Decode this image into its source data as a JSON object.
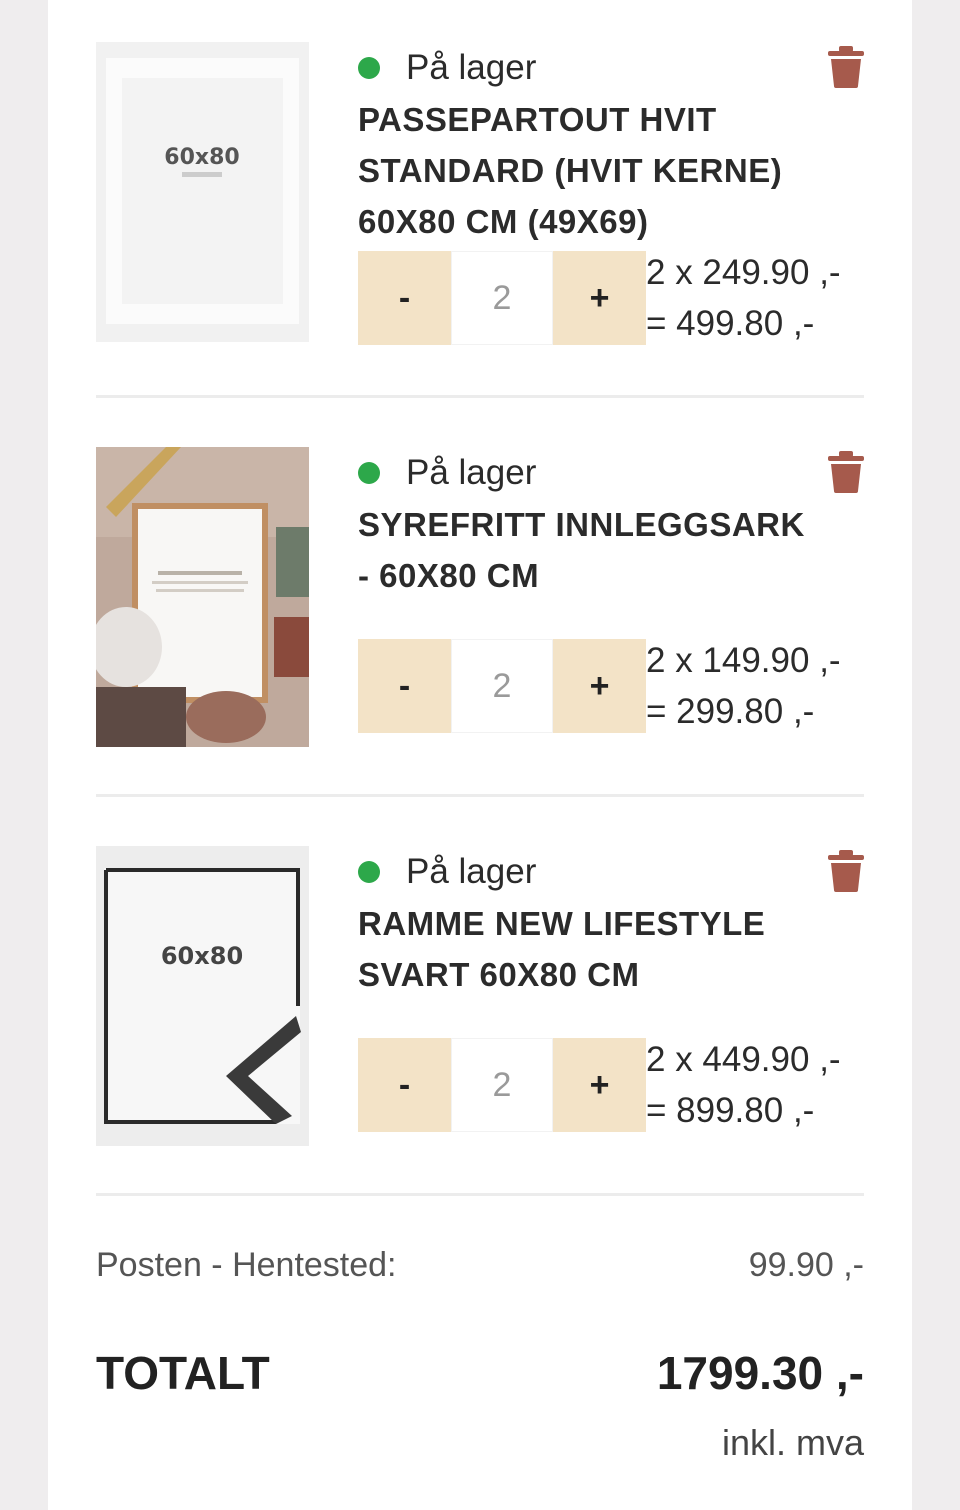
{
  "items": [
    {
      "stock": "På lager",
      "title": "PASSEPARTOUT HVIT STANDARD (HVIT KERNE) 60X80 CM (49X69)",
      "image_label": "60x80",
      "qty_minus": "-",
      "qty": "2",
      "qty_plus": "+",
      "unit_line": "2 x 249.90 ,-",
      "total_line": "= 499.80 ,-"
    },
    {
      "stock": "På lager",
      "title": "SYREFRITT INNLEGGSARK - 60X80 CM",
      "image_label": "",
      "qty_minus": "-",
      "qty": "2",
      "qty_plus": "+",
      "unit_line": "2 x 149.90 ,-",
      "total_line": "= 299.80 ,-"
    },
    {
      "stock": "På lager",
      "title": "RAMME NEW LIFESTYLE SVART 60X80 CM",
      "image_label": "60x80",
      "qty_minus": "-",
      "qty": "2",
      "qty_plus": "+",
      "unit_line": "2 x 449.90 ,-",
      "total_line": "= 899.80 ,-"
    }
  ],
  "shipping": {
    "label": "Posten - Hentested:",
    "value": "99.90 ,-"
  },
  "total": {
    "label": "TOTALT",
    "value": "1799.30 ,-",
    "vat_note": "inkl. mva"
  },
  "colors": {
    "stock_dot": "#2da84a",
    "trash": "#a65a4c",
    "qty_button": "#f3e3c7"
  },
  "icons": {
    "delete": "trash-icon",
    "stock": "in-stock-dot"
  }
}
